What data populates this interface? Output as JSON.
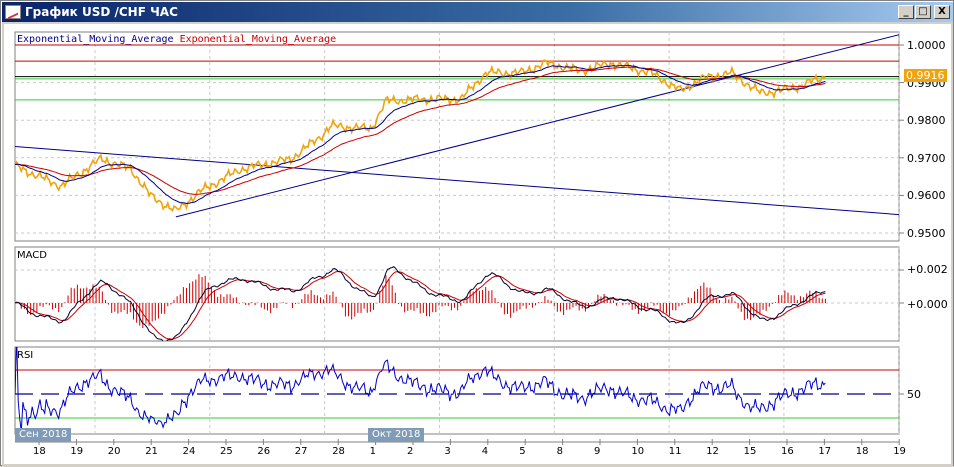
{
  "window": {
    "title": "График USD /CHF ЧАС",
    "minimize": "_",
    "maximize": "□",
    "close": "X"
  },
  "legend": {
    "ema1": "Exponential_Moving_Average",
    "ema2": "Exponential_Moving_Average"
  },
  "panels": {
    "macd_label": "MACD",
    "rsi_label": "RSI"
  },
  "price_axis": [
    "1.0000",
    "0.9900",
    "0.9800",
    "0.9700",
    "0.9600",
    "0.9500"
  ],
  "current_price": "0.9916",
  "macd_axis": [
    "+0.002",
    "+0.000"
  ],
  "rsi_axis": [
    "50"
  ],
  "months": [
    "Сен 2018",
    "Окт 2018"
  ],
  "dates": [
    "18",
    "19",
    "20",
    "21",
    "24",
    "25",
    "26",
    "27",
    "28",
    "1",
    "2",
    "3",
    "4",
    "5",
    "8",
    "9",
    "10",
    "11",
    "12",
    "15",
    "16",
    "17",
    "18",
    "19"
  ],
  "colors": {
    "price": "#f0a30a",
    "ema_fast": "#00008b",
    "ema_slow": "#cc0000",
    "green": "#33cc33",
    "trend": "#00008b",
    "rsi": "#0000cc"
  },
  "chart_data": {
    "type": "line",
    "title": "USD/CHF H1",
    "x_unit": "trading day index (0 = 18 Sep)",
    "price": [
      [
        -0.64,
        0.9678
      ],
      [
        0.59,
        0.9625
      ],
      [
        1.66,
        0.9697
      ],
      [
        2.46,
        0.967
      ],
      [
        2.99,
        0.9598
      ],
      [
        3.66,
        0.9558
      ],
      [
        4.33,
        0.9612
      ],
      [
        5.4,
        0.967
      ],
      [
        6.74,
        0.9697
      ],
      [
        7.54,
        0.9758
      ],
      [
        7.81,
        0.9785
      ],
      [
        8.88,
        0.9777
      ],
      [
        9.28,
        0.9851
      ],
      [
        10.21,
        0.9856
      ],
      [
        11.28,
        0.9856
      ],
      [
        11.95,
        0.9926
      ],
      [
        12.89,
        0.9926
      ],
      [
        13.56,
        0.9952
      ],
      [
        14.49,
        0.9931
      ],
      [
        15.29,
        0.9952
      ],
      [
        16.36,
        0.9926
      ],
      [
        17.17,
        0.9878
      ],
      [
        17.7,
        0.991
      ],
      [
        18.5,
        0.9926
      ],
      [
        19.3,
        0.9872
      ],
      [
        20.1,
        0.9883
      ],
      [
        21.04,
        0.9916
      ]
    ],
    "ylim": [
      0.9475,
      1.0045
    ],
    "hlines": [
      {
        "value": 1.0,
        "color": "#cc0000"
      },
      {
        "value": 0.9957,
        "color": "#cc0000"
      },
      {
        "value": 0.9916,
        "color": "#000000"
      },
      {
        "value": 0.991,
        "color": "#33cc33"
      },
      {
        "value": 0.9854,
        "color": "#33cc33"
      }
    ],
    "trendlines": [
      [
        [
          -0.64,
          0.973
        ],
        [
          23.5,
          0.9545
        ]
      ],
      [
        [
          3.66,
          0.9543
        ],
        [
          23.1,
          1.003
        ]
      ]
    ],
    "macd_ylim": [
      -0.0023,
      0.0047
    ],
    "rsi_levels": [
      70,
      50,
      30
    ]
  }
}
